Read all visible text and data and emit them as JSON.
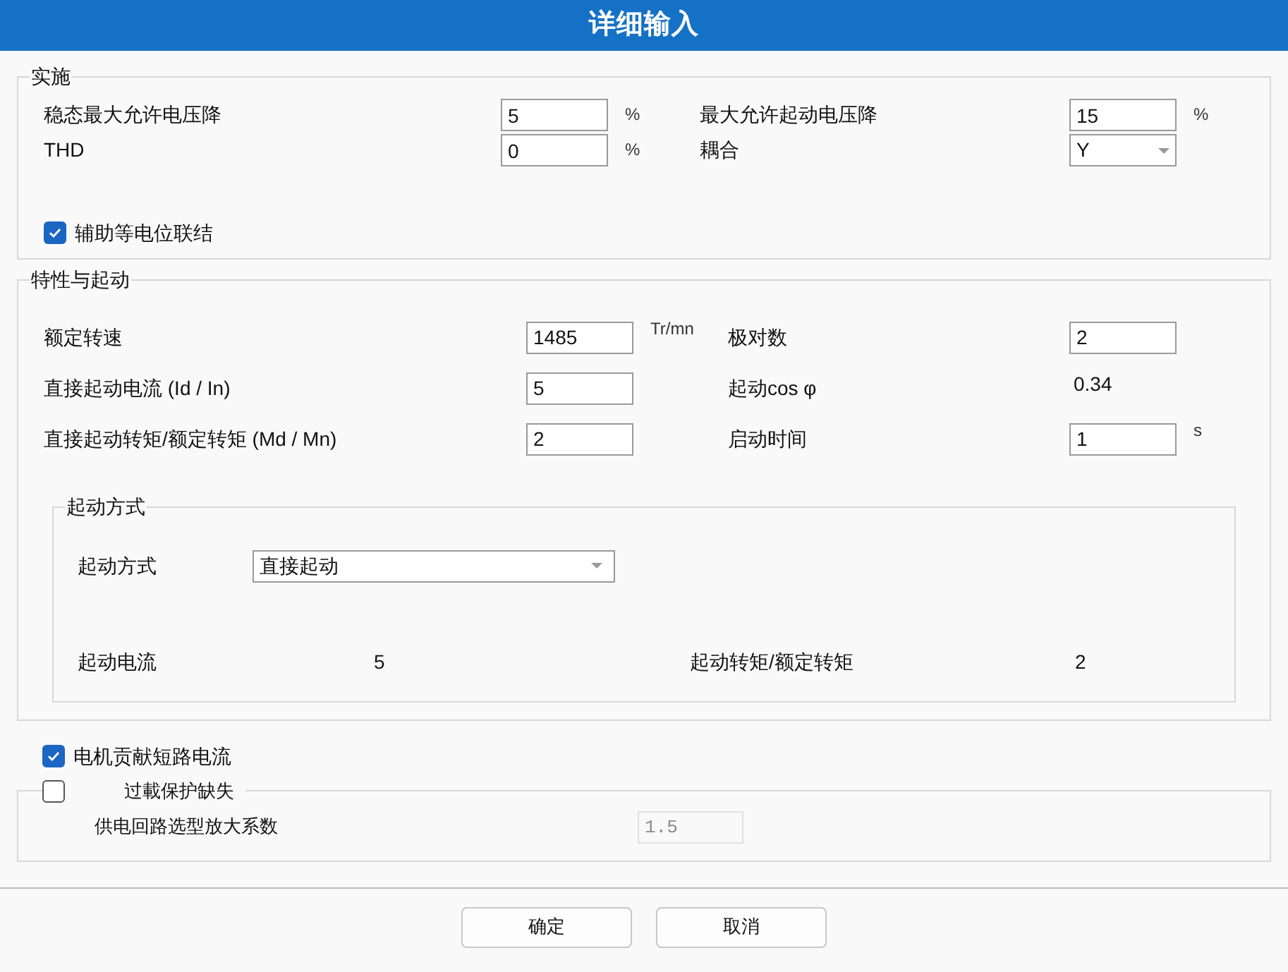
{
  "window": {
    "title": "详细输入"
  },
  "implementation": {
    "title": "实施",
    "fields": [
      {
        "kind": "input",
        "label": "稳态最大允许电压降",
        "value": "5",
        "unit": "%"
      },
      {
        "kind": "input",
        "label": "最大允许起动电压降",
        "value": "15",
        "unit": "%"
      },
      {
        "kind": "input",
        "label": "THD",
        "value": "0",
        "unit": "%"
      },
      {
        "kind": "select",
        "label": "耦合",
        "value": "Y"
      }
    ],
    "checkbox": {
      "label": "辅助等电位联结",
      "checked": true
    }
  },
  "characteristics": {
    "title": "特性与起动",
    "fields": [
      {
        "kind": "input",
        "label": "额定转速",
        "value": "1485",
        "unit": "Tr/mn"
      },
      {
        "kind": "input",
        "label": "极对数",
        "value": "2"
      },
      {
        "kind": "input",
        "label": "直接起动电流 (Id / In)",
        "value": "5"
      },
      {
        "kind": "text",
        "label": "起动cos φ",
        "value": "0.34"
      },
      {
        "kind": "input",
        "label": "直接起动转矩/额定转矩 (Md / Mn)",
        "value": "2"
      },
      {
        "kind": "input",
        "label": "启动时间",
        "value": "1",
        "unit": "s"
      }
    ],
    "start_mode": {
      "title": "起动方式",
      "label": "起动方式",
      "value": "直接起动",
      "results": [
        {
          "label": "起动电流",
          "value": "5"
        },
        {
          "label": "起动转矩/额定转矩",
          "value": "2"
        }
      ]
    }
  },
  "motor_contribution": {
    "label": "电机贡献短路电流",
    "checked": true
  },
  "overload": {
    "label": "过載保护缺失",
    "checked": false,
    "field": {
      "label": "供电回路选型放大系数",
      "value": "1.5",
      "disabled": true
    }
  },
  "buttons": [
    "确定",
    "取消"
  ]
}
